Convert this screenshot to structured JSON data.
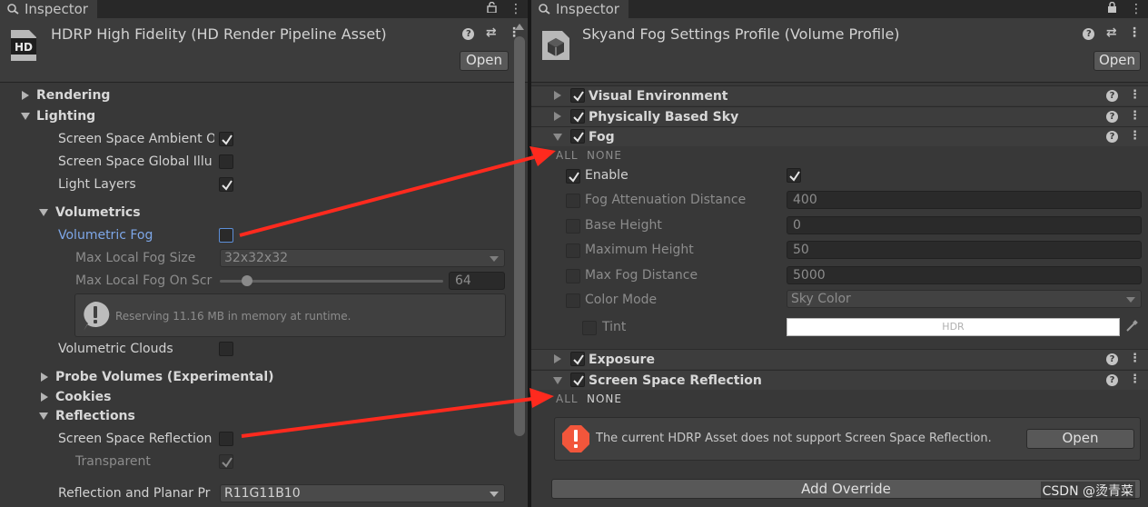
{
  "left": {
    "tab_title": "Inspector",
    "asset_icon_text": "HD",
    "asset_title": "HDRP High Fidelity (HD Render Pipeline Asset)",
    "open_label": "Open",
    "rendering": "Rendering",
    "lighting": "Lighting",
    "ssao": "Screen Space Ambient O",
    "ssgi": "Screen Space Global Illu",
    "light_layers": "Light Layers",
    "volumetrics": "Volumetrics",
    "volumetric_fog": "Volumetric Fog",
    "max_local_fog_size": "Max Local Fog Size",
    "max_local_fog_size_value": "32x32x32",
    "max_local_fog_on_screen": "Max Local Fog On Scr",
    "max_local_fog_on_screen_value": "64",
    "slider_fraction": 0.12,
    "reserve_note": "Reserving 11.16 MB in memory at runtime.",
    "volumetric_clouds": "Volumetric Clouds",
    "probe_volumes": "Probe Volumes (Experimental)",
    "cookies": "Cookies",
    "reflections": "Reflections",
    "ssr": "Screen Space Reflection",
    "transparent": "Transparent",
    "reflection_format": "Reflection and Planar Pr",
    "reflection_format_value": "R11G11B10"
  },
  "right": {
    "tab_title": "Inspector",
    "asset_title": "Skyand Fog Settings Profile (Volume Profile)",
    "open_label": "Open",
    "visual_environment": "Visual Environment",
    "physically_based_sky": "Physically Based Sky",
    "fog": "Fog",
    "all": "ALL",
    "none": "NONE",
    "enable": "Enable",
    "fog_attenuation": "Fog Attenuation Distance",
    "fog_attenuation_value": "400",
    "base_height": "Base Height",
    "base_height_value": "0",
    "maximum_height": "Maximum Height",
    "maximum_height_value": "50",
    "max_fog_distance": "Max Fog Distance",
    "max_fog_distance_value": "5000",
    "color_mode": "Color Mode",
    "color_mode_value": "Sky Color",
    "tint": "Tint",
    "tint_hdr": "HDR",
    "exposure": "Exposure",
    "ssr": "Screen Space Reflection",
    "ssr_warning": "The current HDRP Asset does not support Screen Space Reflection.",
    "ssr_open": "Open",
    "add_override": "Add Override"
  },
  "watermark": "CSDN @烫青菜",
  "colors": {
    "arrow": "#ff2a1e",
    "accent_blue": "#7ea7e8",
    "warning": "#f2563b"
  },
  "icons": [
    "lock-icon",
    "menu-dots-icon",
    "help-icon",
    "preset-icon",
    "checkmark-icon",
    "foldout-arrow-icon",
    "info-icon",
    "warning-icon",
    "eyedropper-icon",
    "volume-cube-icon"
  ]
}
